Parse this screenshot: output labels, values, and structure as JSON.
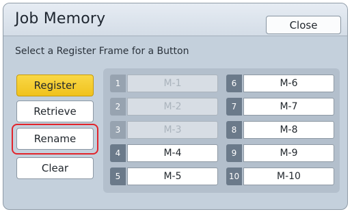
{
  "header": {
    "title": "Job Memory",
    "close_label": "Close"
  },
  "instruction": "Select a Register Frame for a Button",
  "actions": [
    {
      "label": "Register",
      "active": true
    },
    {
      "label": "Retrieve",
      "active": false
    },
    {
      "label": "Rename",
      "active": false,
      "highlighted": true
    },
    {
      "label": "Clear",
      "active": false
    }
  ],
  "slots": [
    {
      "number": "1",
      "name": "M-1",
      "enabled": false
    },
    {
      "number": "2",
      "name": "M-2",
      "enabled": false
    },
    {
      "number": "3",
      "name": "M-3",
      "enabled": false
    },
    {
      "number": "4",
      "name": "M-4",
      "enabled": true
    },
    {
      "number": "5",
      "name": "M-5",
      "enabled": true
    },
    {
      "number": "6",
      "name": "M-6",
      "enabled": true
    },
    {
      "number": "7",
      "name": "M-7",
      "enabled": true
    },
    {
      "number": "8",
      "name": "M-8",
      "enabled": true
    },
    {
      "number": "9",
      "name": "M-9",
      "enabled": true
    },
    {
      "number": "10",
      "name": "M-10",
      "enabled": true
    }
  ],
  "colors": {
    "active_button": "#f3c92a",
    "highlight_outline": "#e2232a",
    "panel_background": "#c4d0dc"
  }
}
